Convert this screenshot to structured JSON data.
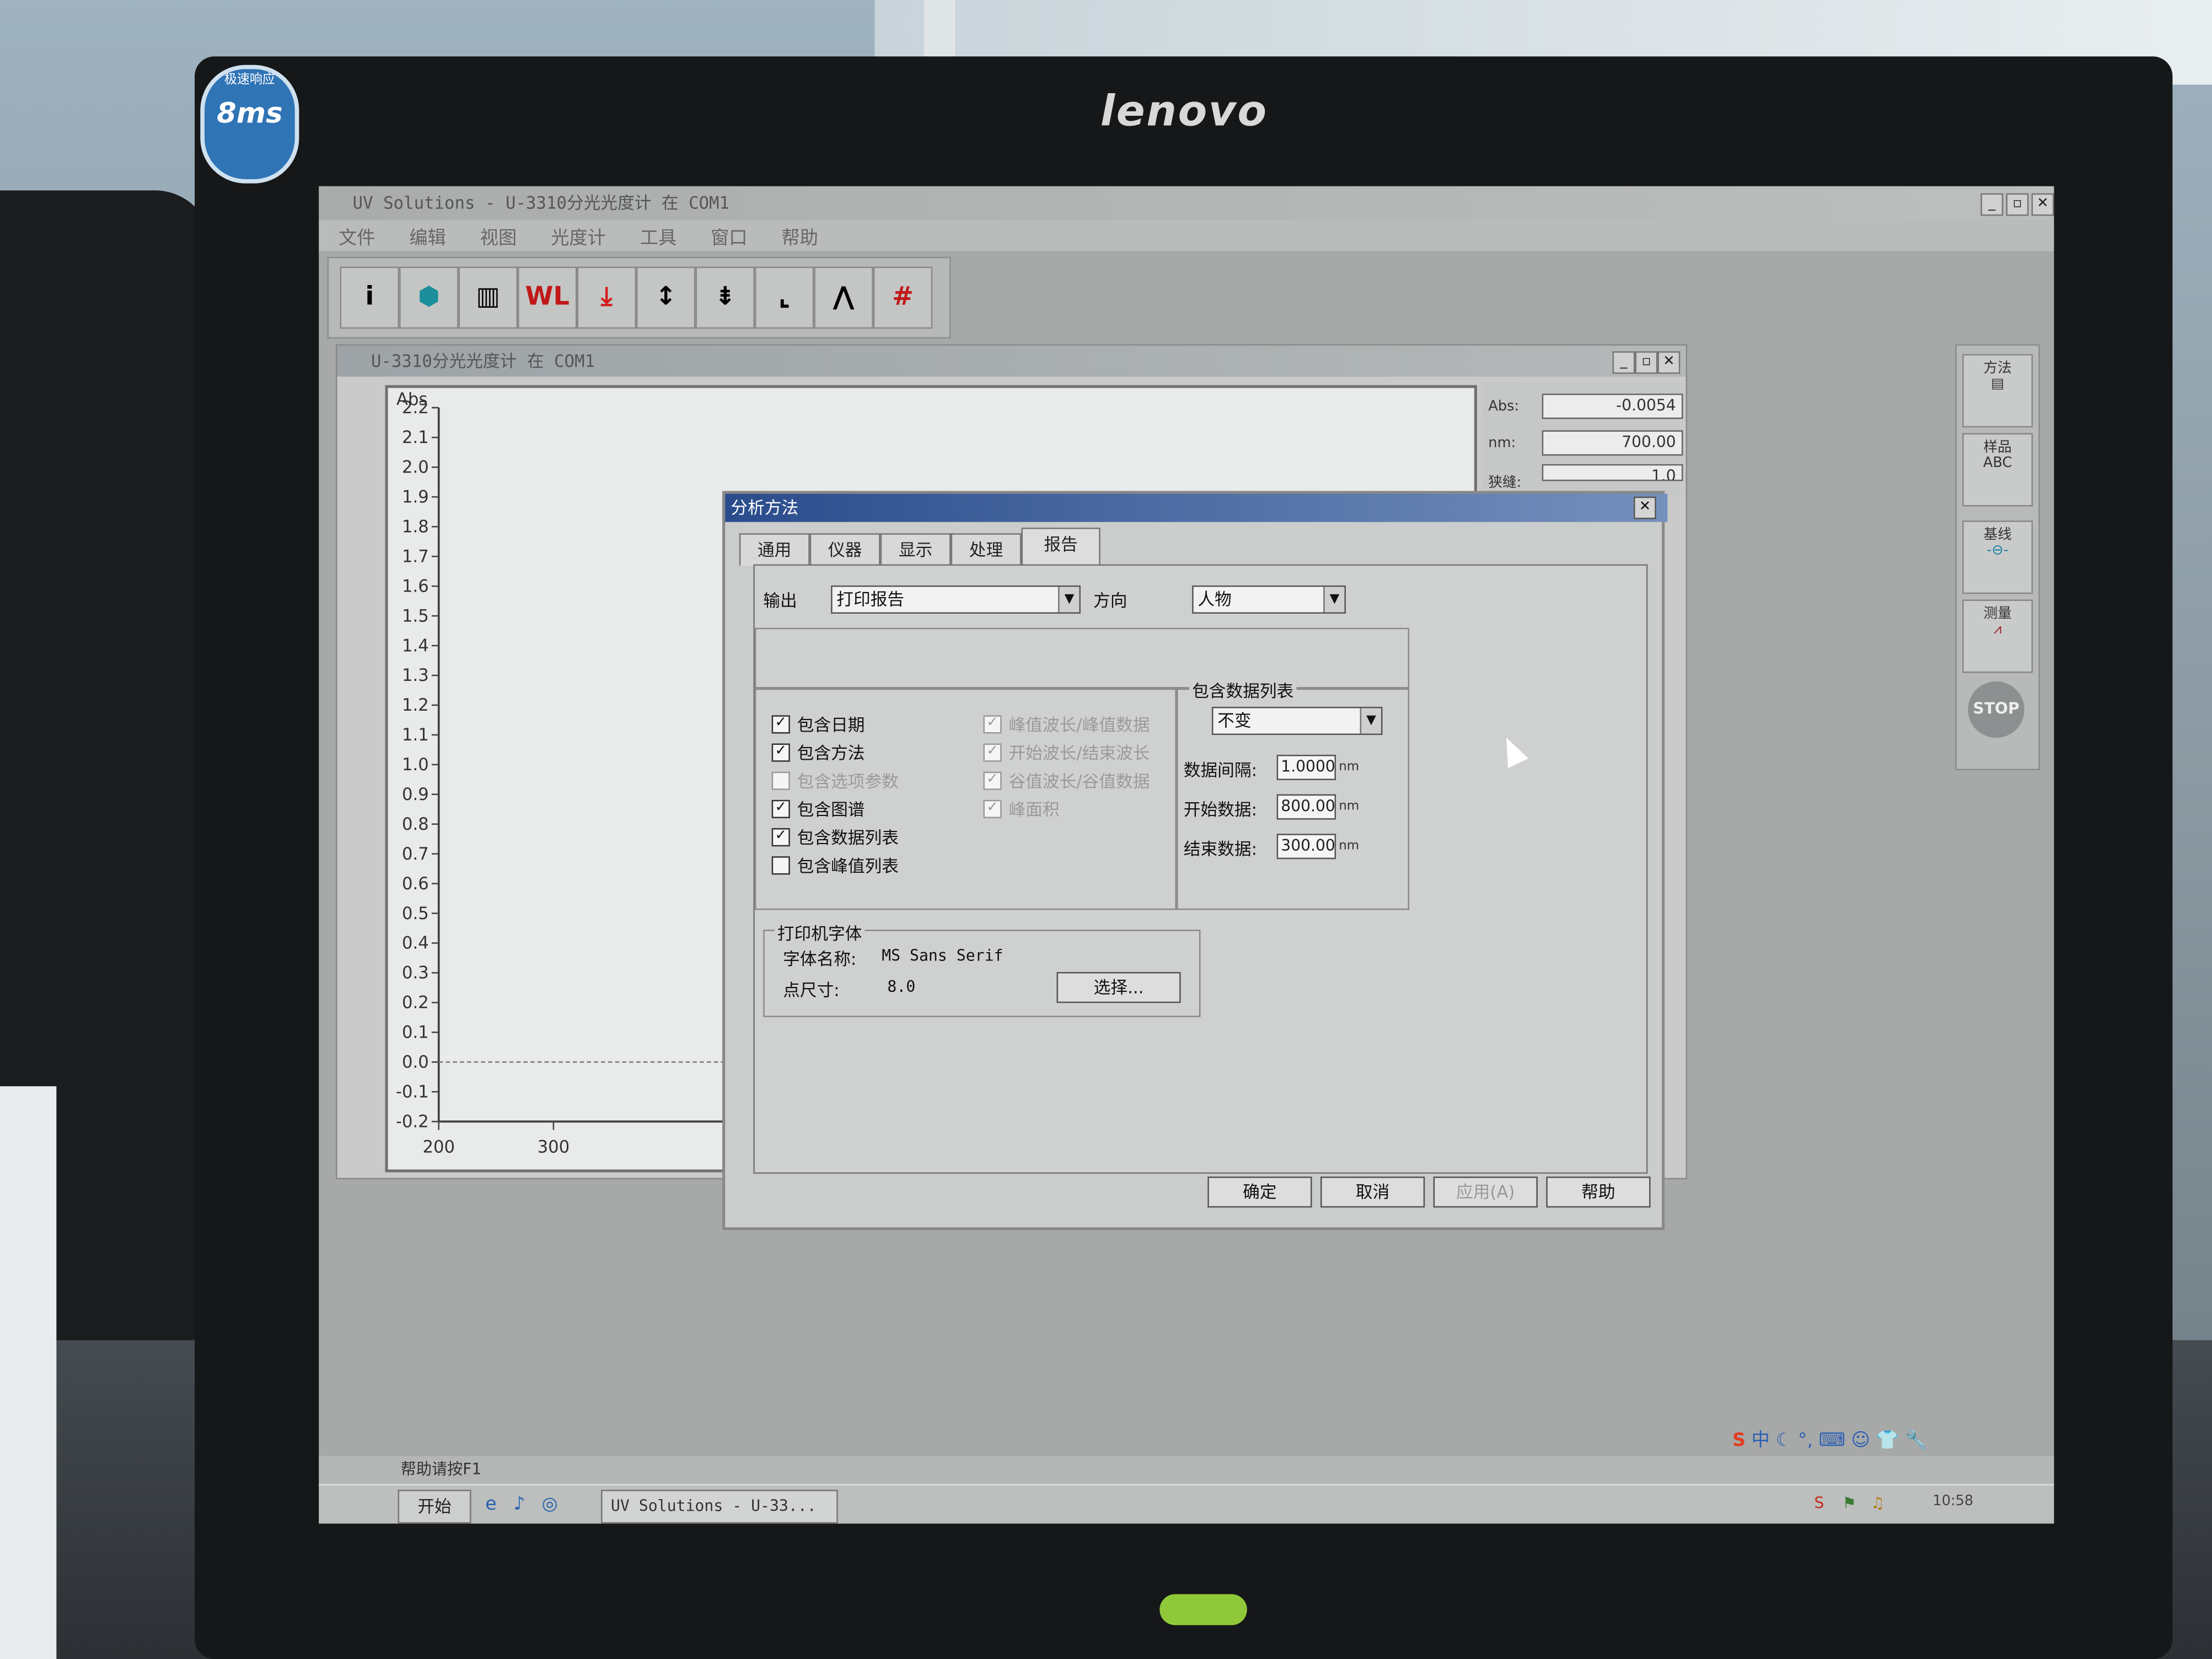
{
  "bezel": {
    "brand": "lenovo",
    "sticker_top": "极速响应",
    "sticker_main": "8ms"
  },
  "app": {
    "title": "UV Solutions - U-3310分光光度计 在 COM1",
    "menu": [
      "文件",
      "编辑",
      "视图",
      "光度计",
      "工具",
      "窗口",
      "帮助"
    ],
    "toolbar_icons": [
      "info-icon",
      "sample-icon",
      "book-icon",
      "wavelength-icon",
      "baseline-icon",
      "scale-expand-icon",
      "scale-compress-icon",
      "zoom-icon",
      "peak-icon",
      "grid-icon"
    ],
    "toolbar_wl": "WL"
  },
  "child_window": {
    "title": "U-3310分光光度计 在 COM1"
  },
  "readouts": {
    "abs_label": "Abs:",
    "abs_value": "-0.0054",
    "nm_label": "nm:",
    "nm_value": "700.00",
    "slit_label": "狭缝:",
    "slit_value": "1.0"
  },
  "chart_data": {
    "type": "line",
    "ylabel": "Abs",
    "y_ticks": [
      "2.2",
      "2.1",
      "2.0",
      "1.9",
      "1.8",
      "1.7",
      "1.6",
      "1.5",
      "1.4",
      "1.3",
      "1.2",
      "1.1",
      "1.0",
      "0.9",
      "0.8",
      "0.7",
      "0.6",
      "0.5",
      "0.4",
      "0.3",
      "0.2",
      "0.1",
      "0.0",
      "-0.1",
      "-0.2"
    ],
    "x_ticks": [
      "200",
      "300"
    ],
    "ylim": [
      -0.2,
      2.2
    ],
    "series": [
      {
        "x": [
          200,
          300
        ],
        "y": [
          0.0,
          0.0
        ]
      }
    ]
  },
  "right_panel": {
    "method": "方法",
    "sample": "样品",
    "sample_icon_text": "ABC",
    "baseline": "基线",
    "measure": "测量",
    "stop": "STOP"
  },
  "dialog": {
    "title": "分析方法",
    "tabs": [
      "通用",
      "仪器",
      "显示",
      "处理",
      "报告"
    ],
    "active_tab": "报告",
    "output_label": "输出",
    "output_value": "打印报告",
    "direction_label": "方向",
    "direction_value": "人物",
    "checks_left": [
      {
        "label": "包含日期",
        "checked": true,
        "enabled": true
      },
      {
        "label": "包含方法",
        "checked": true,
        "enabled": true
      },
      {
        "label": "包含选项参数",
        "checked": false,
        "enabled": false
      },
      {
        "label": "包含图谱",
        "checked": true,
        "enabled": true
      },
      {
        "label": "包含数据列表",
        "checked": true,
        "enabled": true
      },
      {
        "label": "包含峰值列表",
        "checked": false,
        "enabled": true
      }
    ],
    "checks_right": [
      {
        "label": "峰值波长/峰值数据",
        "checked": true,
        "enabled": false
      },
      {
        "label": "开始波长/结束波长",
        "checked": true,
        "enabled": false
      },
      {
        "label": "谷值波长/谷值数据",
        "checked": true,
        "enabled": false
      },
      {
        "label": "峰面积",
        "checked": true,
        "enabled": false
      }
    ],
    "datalist_group": "包含数据列表",
    "datalist_value": "不变",
    "interval_label": "数据间隔:",
    "interval_value": "1.0000",
    "start_label": "开始数据:",
    "start_value": "800.00",
    "end_label": "结束数据:",
    "end_value": "300.00",
    "unit": "nm",
    "font_group": "打印机字体",
    "font_name_label": "字体名称:",
    "font_name_value": "MS Sans Serif",
    "font_size_label": "点尺寸:",
    "font_size_value": "8.0",
    "select_button": "选择...",
    "ok_button": "确定",
    "cancel_button": "取消",
    "apply_button": "应用(A)",
    "help_button": "帮助"
  },
  "statusbar": {
    "text": "帮助请按F1"
  },
  "taskbar": {
    "start": "开始",
    "task": "UV Solutions - U-33...",
    "clock": "10:58",
    "ime": "中"
  }
}
